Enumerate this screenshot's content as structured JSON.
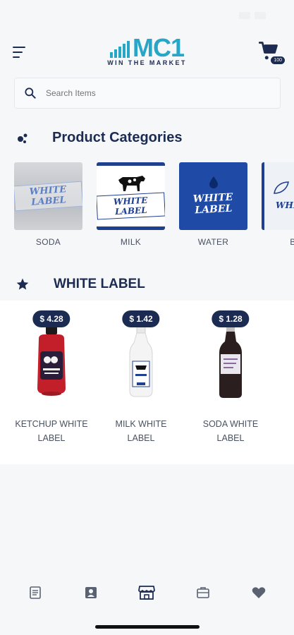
{
  "status": {
    "time": "",
    "battery": ""
  },
  "header": {
    "logo_text": "MC1",
    "logo_tagline": "WIN THE MARKET",
    "cart_count": "100"
  },
  "search": {
    "placeholder": "Search Items"
  },
  "categories_section": {
    "title": "Product Categories",
    "items": [
      {
        "label": "SODA",
        "stamp": "WHITE LABEL"
      },
      {
        "label": "MILK",
        "stamp": "WHITE LABEL"
      },
      {
        "label": "WATER",
        "stamp": "WHITE LABEL"
      },
      {
        "label": "BE",
        "stamp": "WHITE"
      }
    ]
  },
  "brand_section": {
    "title": "WHITE LABEL",
    "products": [
      {
        "price": "$ 4.28",
        "name_line1": "KETCHUP WHITE",
        "name_line2": "LABEL"
      },
      {
        "price": "$ 1.42",
        "name_line1": "MILK WHITE",
        "name_line2": "LABEL"
      },
      {
        "price": "$ 1.28",
        "name_line1": "SODA WHITE",
        "name_line2": "LABEL"
      }
    ]
  },
  "tabbar": {
    "tabs": [
      {
        "icon": "orders-icon"
      },
      {
        "icon": "contacts-icon"
      },
      {
        "icon": "store-icon",
        "active": true
      },
      {
        "icon": "briefcase-icon"
      },
      {
        "icon": "heart-icon"
      }
    ]
  },
  "colors": {
    "primary": "#1c2b52",
    "accent": "#27a6c8",
    "water_bg": "#1f4aa6"
  }
}
